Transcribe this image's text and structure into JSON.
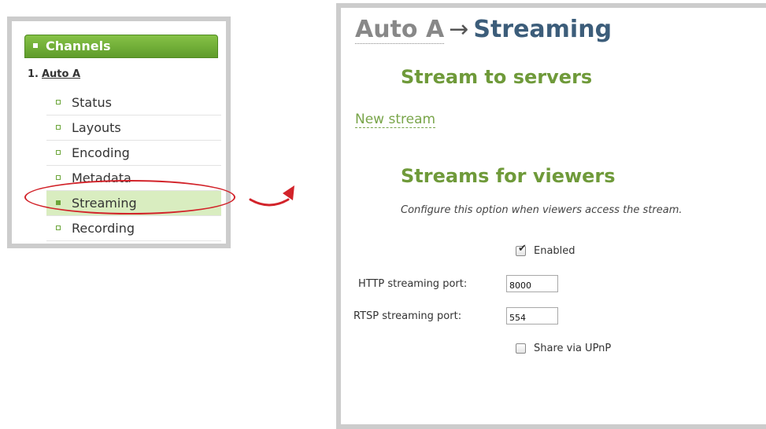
{
  "sidebar": {
    "header": "Channels",
    "channel_number": "1.",
    "channel_name": "Auto A",
    "items": [
      {
        "label": "Status"
      },
      {
        "label": "Layouts"
      },
      {
        "label": "Encoding"
      },
      {
        "label": "Metadata"
      },
      {
        "label": "Streaming"
      },
      {
        "label": "Recording"
      }
    ],
    "active_item": "Streaming"
  },
  "breadcrumb": {
    "parent": "Auto A",
    "separator": "→",
    "current": "Streaming"
  },
  "stream_to_servers": {
    "title": "Stream to servers",
    "new_stream_link": "New stream"
  },
  "streams_for_viewers": {
    "title": "Streams for viewers",
    "hint": "Configure this option when viewers access the stream.",
    "enabled_label": "Enabled",
    "enabled_checked": true,
    "http_port_label": "HTTP streaming port:",
    "http_port_value": "8000",
    "rtsp_port_label": "RTSP streaming port:",
    "rtsp_port_value": "554",
    "upnp_label": "Share via UPnP",
    "upnp_checked": false
  },
  "colors": {
    "accent_green": "#6f9a3a",
    "header_green": "#5f9c2b",
    "active_bg": "#d9edc0",
    "annotation_red": "#d2232a",
    "title_blue": "#3c5d7a"
  }
}
